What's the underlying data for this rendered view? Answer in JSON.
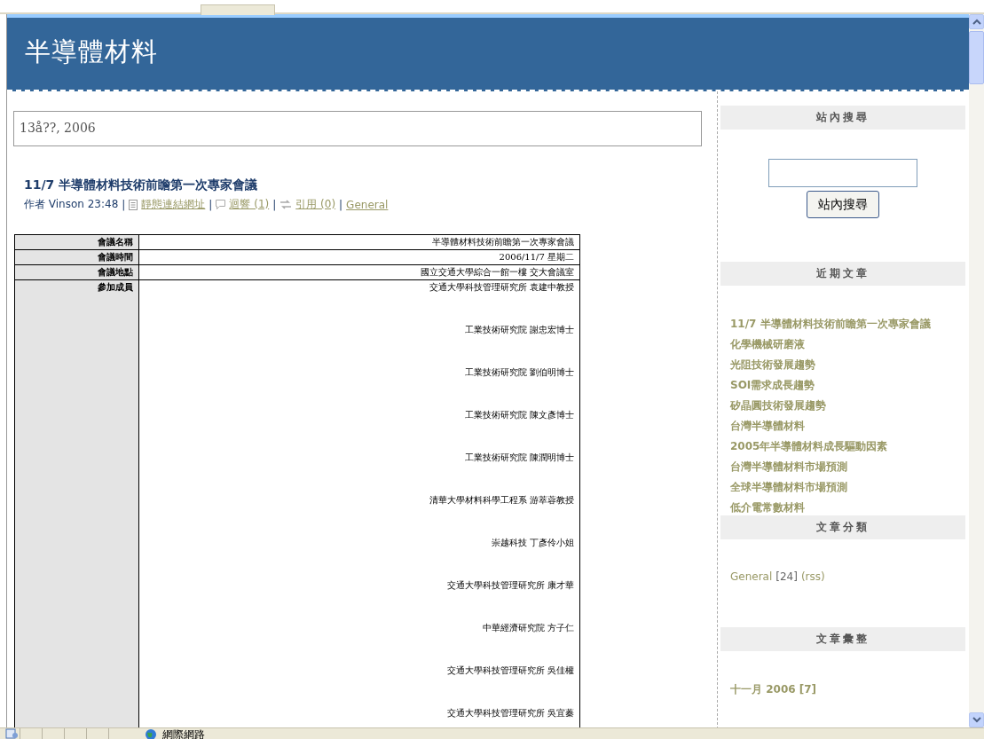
{
  "blog": {
    "title": "半導體材料"
  },
  "date_header": "13å??, 2006",
  "post": {
    "title": "11/7 半導體材料技術前瞻第一次專家會議",
    "byline": "作者 Vinson 23:48",
    "separator": "|",
    "links": [
      {
        "kind": "permalink",
        "label": "靜態連結網址"
      },
      {
        "kind": "comments",
        "label": "迴響 (1)"
      },
      {
        "kind": "trackback",
        "label": "引用 (0)"
      },
      {
        "kind": "category",
        "label": "General"
      }
    ],
    "table": [
      {
        "label": "會議名稱",
        "values": [
          "半導體材料技術前瞻第一次專家會議"
        ]
      },
      {
        "label": "會議時間",
        "values": [
          "2006/11/7 星期二"
        ]
      },
      {
        "label": "會議地點",
        "values": [
          "國立交通大學綜合一館一樓 交大會議室"
        ]
      },
      {
        "label": "參加成員",
        "values": [
          "交通大學科技管理研究所 袁建中教授",
          "工業技術研究院 謝忠宏博士",
          "工業技術研究院 劉伯明博士",
          "工業技術研究院 陳文彥博士",
          "工業技術研究院 陳潤明博士",
          "清華大學材料科學工程系 游萃蓉教授",
          "崇越科技 丁彥伶小姐",
          "交通大學科技管理研究所 康才華",
          "中華經濟研究院 方子仁",
          "交通大學科技管理研究所 吳佳權",
          "交通大學科技管理研究所 吳宜蓁"
        ]
      }
    ]
  },
  "sidebar": [
    {
      "kind": "search",
      "title": "站內搜尋",
      "button": "站內搜尋"
    },
    {
      "kind": "links",
      "title": "近期文章",
      "items": [
        "11/7 半導體材料技術前瞻第一次專家會議",
        "化學機械研磨液",
        "光阻技術發展趨勢",
        "SOI需求成長趨勢",
        "矽晶圓技術發展趨勢",
        "台灣半導體材料",
        "2005年半導體材料成長驅動因素",
        "台灣半導體材料市場預測",
        "全球半導體材料市場預測",
        "低介電常數材料"
      ]
    },
    {
      "kind": "categories",
      "title": "文章分類",
      "items": [
        {
          "name": "General",
          "count": "[24]",
          "feed": "(rss)"
        }
      ]
    },
    {
      "kind": "links",
      "title": "文章彙整",
      "items": [
        "十一月 2006 [7]"
      ]
    }
  ],
  "status_bar": {
    "zone": "網際網路"
  }
}
